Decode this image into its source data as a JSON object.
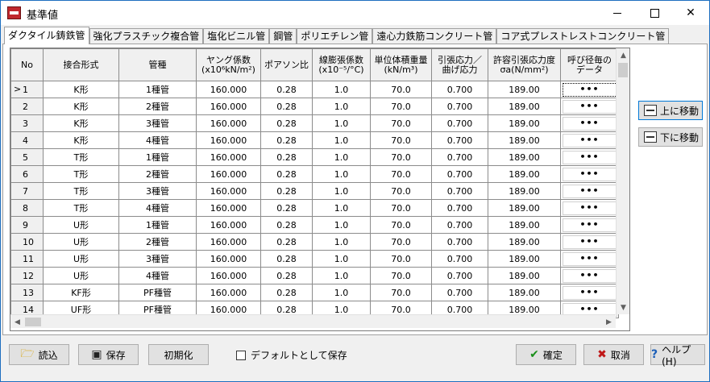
{
  "window": {
    "title": "基準値",
    "minimize": "",
    "maximize": "",
    "close": "✕"
  },
  "tabs": [
    {
      "label": "ダクタイル鋳鉄管",
      "active": true
    },
    {
      "label": "強化プラスチック複合管"
    },
    {
      "label": "塩化ビニル管"
    },
    {
      "label": "鋼管"
    },
    {
      "label": "ポリエチレン管"
    },
    {
      "label": "遠心力鉄筋コンクリート管"
    },
    {
      "label": "コア式プレストレストコンクリート管"
    }
  ],
  "grid": {
    "columns": [
      {
        "line1": "No",
        "line2": ""
      },
      {
        "line1": "接合形式",
        "line2": ""
      },
      {
        "line1": "管種",
        "line2": ""
      },
      {
        "line1": "ヤング係数",
        "line2": "(x10⁶kN/m²)"
      },
      {
        "line1": "ポアソン比",
        "line2": ""
      },
      {
        "line1": "線膨張係数",
        "line2": "(x10⁻⁵/°C)"
      },
      {
        "line1": "単位体積重量",
        "line2": "(kN/m³)"
      },
      {
        "line1": "引張応力／",
        "line2": "曲げ応力"
      },
      {
        "line1": "許容引張応力度",
        "line2": "σa(N/mm²)"
      },
      {
        "line1": "呼び径毎の",
        "line2": "データ"
      }
    ],
    "current_marker": ">",
    "rows": [
      {
        "no": "1",
        "joint": "K形",
        "type": "1種管",
        "young": "160.000",
        "poisson": "0.28",
        "expansion": "1.0",
        "unit_weight": "70.0",
        "stress_ratio": "0.700",
        "allowable": "189.00",
        "data": "•••"
      },
      {
        "no": "2",
        "joint": "K形",
        "type": "2種管",
        "young": "160.000",
        "poisson": "0.28",
        "expansion": "1.0",
        "unit_weight": "70.0",
        "stress_ratio": "0.700",
        "allowable": "189.00",
        "data": "•••"
      },
      {
        "no": "3",
        "joint": "K形",
        "type": "3種管",
        "young": "160.000",
        "poisson": "0.28",
        "expansion": "1.0",
        "unit_weight": "70.0",
        "stress_ratio": "0.700",
        "allowable": "189.00",
        "data": "•••"
      },
      {
        "no": "4",
        "joint": "K形",
        "type": "4種管",
        "young": "160.000",
        "poisson": "0.28",
        "expansion": "1.0",
        "unit_weight": "70.0",
        "stress_ratio": "0.700",
        "allowable": "189.00",
        "data": "•••"
      },
      {
        "no": "5",
        "joint": "T形",
        "type": "1種管",
        "young": "160.000",
        "poisson": "0.28",
        "expansion": "1.0",
        "unit_weight": "70.0",
        "stress_ratio": "0.700",
        "allowable": "189.00",
        "data": "•••"
      },
      {
        "no": "6",
        "joint": "T形",
        "type": "2種管",
        "young": "160.000",
        "poisson": "0.28",
        "expansion": "1.0",
        "unit_weight": "70.0",
        "stress_ratio": "0.700",
        "allowable": "189.00",
        "data": "•••"
      },
      {
        "no": "7",
        "joint": "T形",
        "type": "3種管",
        "young": "160.000",
        "poisson": "0.28",
        "expansion": "1.0",
        "unit_weight": "70.0",
        "stress_ratio": "0.700",
        "allowable": "189.00",
        "data": "•••"
      },
      {
        "no": "8",
        "joint": "T形",
        "type": "4種管",
        "young": "160.000",
        "poisson": "0.28",
        "expansion": "1.0",
        "unit_weight": "70.0",
        "stress_ratio": "0.700",
        "allowable": "189.00",
        "data": "•••"
      },
      {
        "no": "9",
        "joint": "U形",
        "type": "1種管",
        "young": "160.000",
        "poisson": "0.28",
        "expansion": "1.0",
        "unit_weight": "70.0",
        "stress_ratio": "0.700",
        "allowable": "189.00",
        "data": "•••"
      },
      {
        "no": "10",
        "joint": "U形",
        "type": "2種管",
        "young": "160.000",
        "poisson": "0.28",
        "expansion": "1.0",
        "unit_weight": "70.0",
        "stress_ratio": "0.700",
        "allowable": "189.00",
        "data": "•••"
      },
      {
        "no": "11",
        "joint": "U形",
        "type": "3種管",
        "young": "160.000",
        "poisson": "0.28",
        "expansion": "1.0",
        "unit_weight": "70.0",
        "stress_ratio": "0.700",
        "allowable": "189.00",
        "data": "•••"
      },
      {
        "no": "12",
        "joint": "U形",
        "type": "4種管",
        "young": "160.000",
        "poisson": "0.28",
        "expansion": "1.0",
        "unit_weight": "70.0",
        "stress_ratio": "0.700",
        "allowable": "189.00",
        "data": "•••"
      },
      {
        "no": "13",
        "joint": "KF形",
        "type": "PF種管",
        "young": "160.000",
        "poisson": "0.28",
        "expansion": "1.0",
        "unit_weight": "70.0",
        "stress_ratio": "0.700",
        "allowable": "189.00",
        "data": "•••"
      },
      {
        "no": "14",
        "joint": "UF形",
        "type": "PF種管",
        "young": "160.000",
        "poisson": "0.28",
        "expansion": "1.0",
        "unit_weight": "70.0",
        "stress_ratio": "0.700",
        "allowable": "189.00",
        "data": "•••"
      }
    ]
  },
  "side": {
    "move_up": "上に移動",
    "move_down": "下に移動"
  },
  "bottom": {
    "load": "読込",
    "save": "保存",
    "init": "初期化",
    "default_save": "デフォルトとして保存",
    "ok": "確定",
    "cancel": "取消",
    "help": "ヘルプ(H)"
  },
  "icons": {
    "load": "folder-icon",
    "save": "disk-icon",
    "ok": "check-icon",
    "cancel": "x-icon",
    "help": "question-icon"
  }
}
